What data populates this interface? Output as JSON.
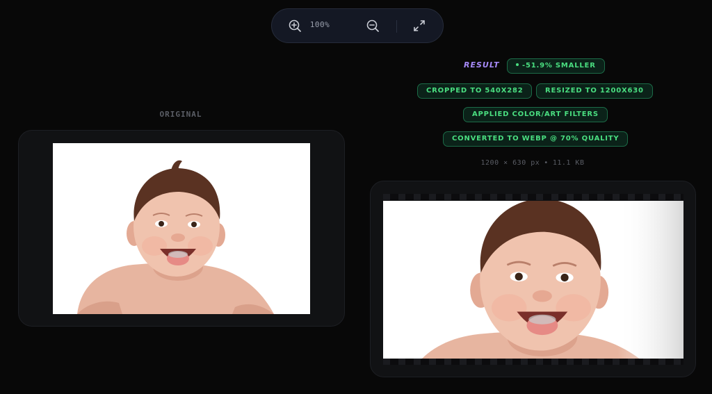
{
  "toolbar": {
    "zoom_in_icon": "zoom-in-icon",
    "zoom_level": "100%",
    "zoom_out_icon": "zoom-out-icon",
    "fullscreen_icon": "expand-icon"
  },
  "original": {
    "label": "ORIGINAL"
  },
  "result": {
    "label": "RESULT",
    "size_change": "-51.9% SMALLER",
    "operations": [
      "CROPPED TO 540X282",
      "RESIZED TO 1200X630",
      "APPLIED COLOR/ART FILTERS",
      "CONVERTED TO WEBP @ 70% QUALITY"
    ],
    "dimensions": "1200 × 630 px",
    "separator": "•",
    "file_size": "11.1 KB"
  },
  "colors": {
    "background": "#080808",
    "accent_purple": "#a78bfa",
    "chip_green": "#4ade80",
    "chip_border": "#1c6b47"
  }
}
